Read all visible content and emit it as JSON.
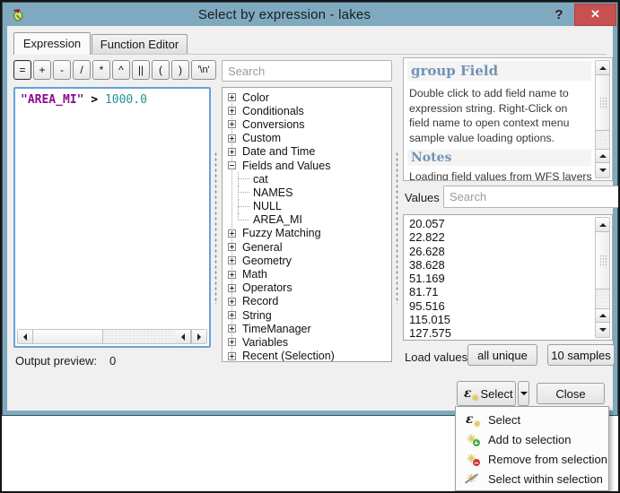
{
  "window": {
    "title": "Select by expression - lakes",
    "help_glyph": "?",
    "close_glyph": "✕"
  },
  "tabs": [
    {
      "label": "Expression",
      "active": true
    },
    {
      "label": "Function Editor",
      "active": false
    }
  ],
  "operators": [
    "=",
    "+",
    "-",
    "/",
    "*",
    "^",
    "||",
    "(",
    ")",
    "'\\n'"
  ],
  "expression": {
    "field": "\"AREA_MI\"",
    "operator": " > ",
    "value": "1000.0"
  },
  "output_preview": {
    "label": "Output preview:",
    "value": "0"
  },
  "function_tree": {
    "search_placeholder": "Search",
    "items": [
      {
        "label": "Color",
        "type": "plus"
      },
      {
        "label": "Conditionals",
        "type": "plus"
      },
      {
        "label": "Conversions",
        "type": "plus"
      },
      {
        "label": "Custom",
        "type": "plus"
      },
      {
        "label": "Date and Time",
        "type": "plus"
      },
      {
        "label": "Fields and Values",
        "type": "minus"
      },
      {
        "label": "cat",
        "type": "child"
      },
      {
        "label": "NAMES",
        "type": "child"
      },
      {
        "label": "NULL",
        "type": "child"
      },
      {
        "label": "AREA_MI",
        "type": "child"
      },
      {
        "label": "Fuzzy Matching",
        "type": "plus"
      },
      {
        "label": "General",
        "type": "plus"
      },
      {
        "label": "Geometry",
        "type": "plus"
      },
      {
        "label": "Math",
        "type": "plus"
      },
      {
        "label": "Operators",
        "type": "plus"
      },
      {
        "label": "Record",
        "type": "plus"
      },
      {
        "label": "String",
        "type": "plus"
      },
      {
        "label": "TimeManager",
        "type": "plus"
      },
      {
        "label": "Variables",
        "type": "plus"
      },
      {
        "label": "Recent (Selection)",
        "type": "plus"
      }
    ]
  },
  "help_panel": {
    "heading": "group Field",
    "body": "Double click to add field name to expression string. Right-Click on field name to open context menu sample value loading options.",
    "notes_heading": "Notes",
    "notes_truncated": "Loading field values from WFS layers"
  },
  "values_panel": {
    "label": "Values",
    "search_placeholder": "Search",
    "values": [
      "20.057",
      "22.822",
      "26.628",
      "38.628",
      "51.169",
      "81.71",
      "95.516",
      "115.015",
      "127.575"
    ],
    "load_values_label": "Load values",
    "all_unique_button": "all unique",
    "samples_button": "10 samples"
  },
  "actions": {
    "select_button": "Select",
    "close_button": "Close"
  },
  "menu": {
    "items": [
      {
        "label": "Select",
        "icon": "epsilon-select"
      },
      {
        "label": "Add to selection",
        "icon": "add-selection"
      },
      {
        "label": "Remove from selection",
        "icon": "remove-selection"
      },
      {
        "label": "Select within selection",
        "icon": "within-selection"
      }
    ]
  },
  "icons": {
    "epsilon": "ε",
    "star": "✳"
  },
  "colors": {
    "titlebar_bg": "#7fa9bf",
    "close_button_bg": "#c75050",
    "dialog_bg": "#f0f0f0",
    "focus_border": "#68a1d8",
    "syntax_field": "#8b0a8f",
    "syntax_number": "#1f9398",
    "help_heading": "#7193b3",
    "star_yellow": "#e9d34b"
  }
}
